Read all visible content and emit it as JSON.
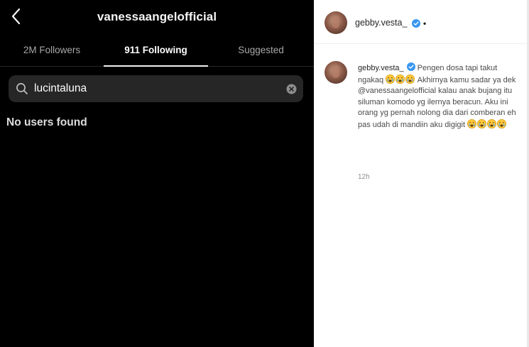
{
  "left_panel": {
    "back_icon": "chevron-left-icon",
    "profile_name": "vanessaangelofficial",
    "tabs": [
      {
        "label": "2M Followers",
        "active": false
      },
      {
        "label": "911 Following",
        "active": true
      },
      {
        "label": "Suggested",
        "active": false
      }
    ],
    "search": {
      "value": "lucintaluna",
      "icon": "search-icon",
      "clear_icon": "clear-icon"
    },
    "empty_message": "No users found"
  },
  "right_panel": {
    "header": {
      "username": "gebby.vesta_",
      "verified": true,
      "dot": "•"
    },
    "comment": {
      "username": "gebby.vesta_",
      "verified": true,
      "text_part1": "Pengen dosa tapi takut ngakaq",
      "emoji_run1": 3,
      "text_part2": "Akhirnya kamu sadar ya dek @vanessaangelofficial kalau anak bujang itu siluman komodo yg ilernya beracun. Aku ini orang yg pernah nolong dia dari comberan eh pas udah di mandiin aku digigit",
      "emoji_run2": 4,
      "emoji_icon": "crying-face-icon",
      "time": "12h"
    }
  },
  "colors": {
    "dark_bg": "#000000",
    "search_bg": "#262626",
    "verified_blue": "#3897f0",
    "emoji_yellow": "#ffc83d"
  }
}
